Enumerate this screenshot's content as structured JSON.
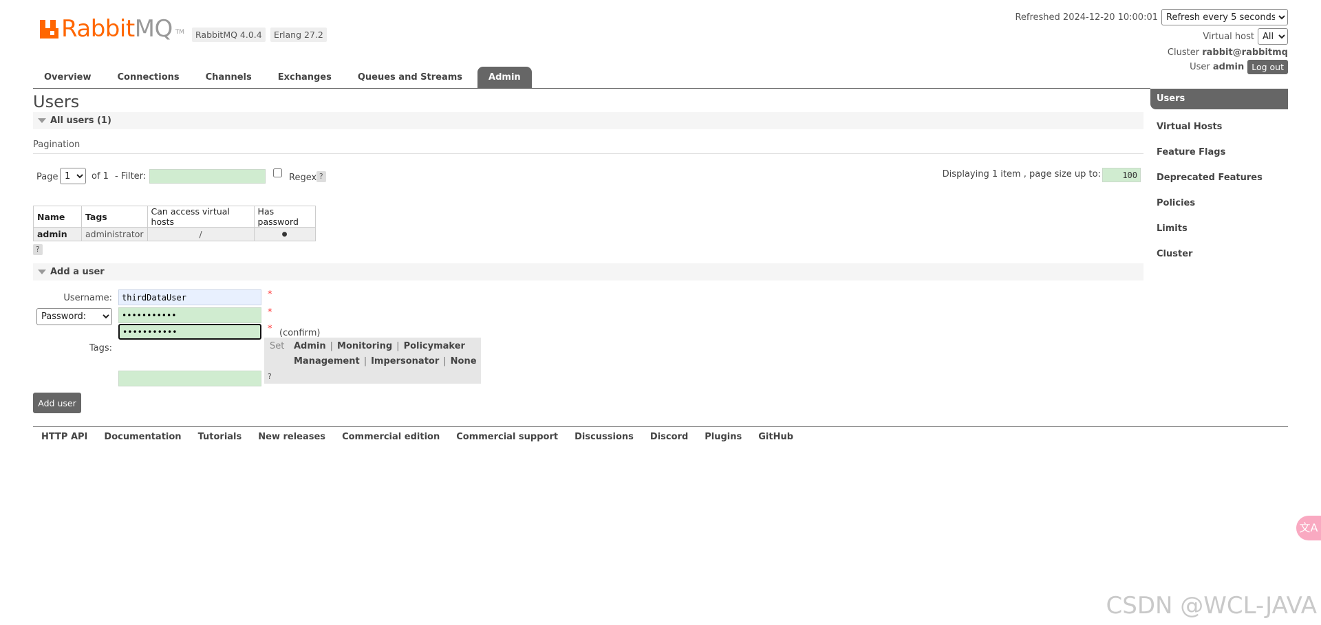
{
  "header": {
    "logo_main": "Rabbit",
    "logo_mq": "MQ",
    "logo_tm": "TM",
    "rabbitmq_version": "RabbitMQ 4.0.4",
    "erlang_version": "Erlang 27.2"
  },
  "status": {
    "refreshed_label": "Refreshed 2024-12-20 10:00:01",
    "refresh_option": "Refresh every 5 seconds",
    "vhost_label": "Virtual host",
    "vhost_value": "All",
    "cluster_label": "Cluster",
    "cluster_value": "rabbit@rabbitmq",
    "user_label": "User",
    "user_value": "admin",
    "logout": "Log out"
  },
  "tabs": [
    {
      "label": "Overview",
      "active": false
    },
    {
      "label": "Connections",
      "active": false
    },
    {
      "label": "Channels",
      "active": false
    },
    {
      "label": "Exchanges",
      "active": false
    },
    {
      "label": "Queues and Streams",
      "active": false
    },
    {
      "label": "Admin",
      "active": true
    }
  ],
  "rightnav": [
    {
      "label": "Users",
      "active": true
    },
    {
      "label": "Virtual Hosts"
    },
    {
      "label": "Feature Flags"
    },
    {
      "label": "Deprecated Features"
    },
    {
      "label": "Policies"
    },
    {
      "label": "Limits"
    },
    {
      "label": "Cluster"
    }
  ],
  "page": {
    "title": "Users",
    "all_users_section": "All users (1)",
    "pagination_label": "Pagination",
    "page_label": "Page",
    "page_value": "1",
    "of_label": "of 1",
    "filter_label": "- Filter:",
    "filter_value": "",
    "regex_label": "Regex",
    "help": "?",
    "displaying_label": "Displaying 1 item , page size up to:",
    "page_size": "100"
  },
  "users_table": {
    "headers": [
      "Name",
      "Tags",
      "Can access virtual hosts",
      "Has password"
    ],
    "rows": [
      {
        "name": "admin",
        "tags": "administrator",
        "vhosts": "/",
        "has_password": "●"
      }
    ]
  },
  "add_user": {
    "section_title": "Add a user",
    "username_label": "Username:",
    "username_value": "thirdDataUser",
    "password_select": "Password:",
    "password_value": "•••••••••••",
    "confirm_value": "•••••••••••",
    "confirm_label": "(confirm)",
    "required_mark": "*",
    "tags_label": "Tags:",
    "tags_value": "",
    "set_label": "Set",
    "tag_options": [
      "Admin",
      "Monitoring",
      "Policymaker",
      "Management",
      "Impersonator",
      "None"
    ],
    "button": "Add user"
  },
  "footer": [
    "HTTP API",
    "Documentation",
    "Tutorials",
    "New releases",
    "Commercial edition",
    "Commercial support",
    "Discussions",
    "Discord",
    "Plugins",
    "GitHub"
  ],
  "watermark": "CSDN @WCL-JAVA",
  "translate_icon": "文A"
}
